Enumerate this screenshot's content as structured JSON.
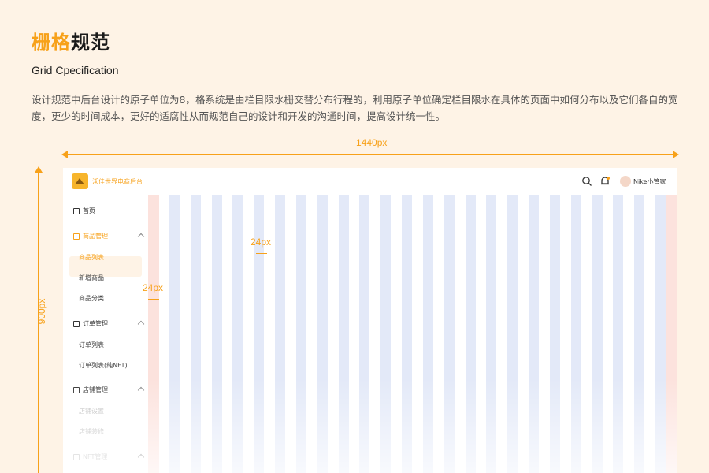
{
  "heading": {
    "accent": "栅格",
    "rest": "规范"
  },
  "subtitle": "Grid Cpecification",
  "description": "设计规范中后台设计的原子单位为8，格系统是由栏目限水栅交替分布行程的，利用原子单位确定栏目限水在具体的页面中如何分布以及它们各自的宽度，更少的时间成本，更好的适腐性从而规范自己的设计和开发的沟通时间，提高设计统一性。",
  "dimensions": {
    "width_label": "1440px",
    "height_label": "900px"
  },
  "gutters": {
    "gutter_label": "24px",
    "margin_label": "24px"
  },
  "colors": {
    "accent": "#F7A11A",
    "background": "#FEF3E6",
    "column": "#E3E9F8",
    "margin": "#FCE2DD"
  },
  "app": {
    "brand": "沃佳世界电商后台",
    "user": "Nike小管家",
    "icons": [
      "search-icon",
      "bell-icon",
      "avatar"
    ],
    "menu": [
      {
        "label": "首页",
        "icon": "home-icon"
      },
      {
        "label": "商品管理",
        "icon": "box-icon",
        "expanded": true,
        "children": [
          "商品列表",
          "新增商品",
          "商品分类"
        ],
        "active_child": "商品列表"
      },
      {
        "label": "订单管理",
        "icon": "order-icon",
        "expanded": true,
        "children": [
          "订单列表",
          "订单列表(纯NFT)"
        ]
      },
      {
        "label": "店铺管理",
        "icon": "shop-icon",
        "expanded": true,
        "children": [
          "店铺设置",
          "店铺装修"
        ]
      },
      {
        "label": "NFT管理",
        "icon": "nft-icon",
        "expanded": true
      }
    ]
  },
  "grid": {
    "columns": 24
  }
}
